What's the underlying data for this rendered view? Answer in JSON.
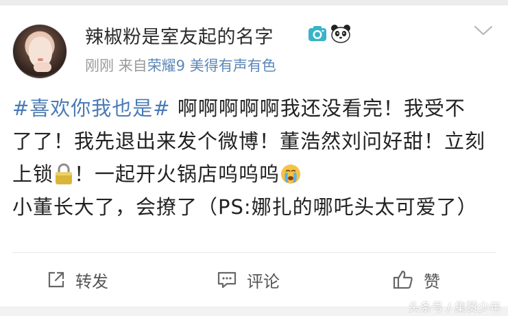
{
  "post": {
    "username": "辣椒粉是室友起的名字",
    "badges": [
      "camera-icon",
      "panda-icon"
    ],
    "time": "刚刚",
    "source_prefix": "来自",
    "device": "荣耀9 美得有声有色",
    "topic": "#喜欢你我也是#",
    "text_1": " 啊啊啊啊啊我还没看完！我受不了了！我先退出来发个微博！董浩然刘问好甜！立刻上锁",
    "text_2": "！一起开火锅店呜呜呜",
    "text_3": "小董长大了，会撩了（PS:娜扎的哪吒头太可爱了）"
  },
  "actions": {
    "repost": "转发",
    "comment": "评论",
    "like": "赞"
  },
  "watermark": "头条号 / 集赞少年",
  "colors": {
    "topic": "#4a7bb5",
    "device": "#5c87b8",
    "meta": "#9a9a9a",
    "background": "#f2f2f2"
  }
}
